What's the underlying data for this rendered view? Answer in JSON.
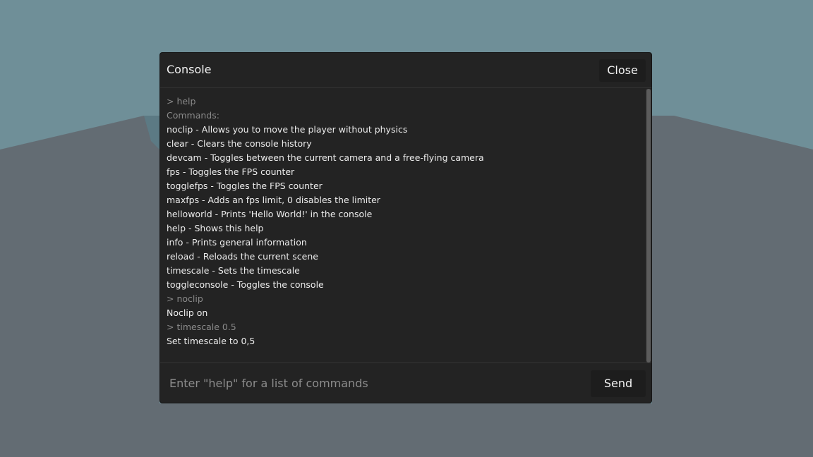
{
  "window": {
    "title": "Console",
    "close_label": "Close"
  },
  "log": [
    {
      "text": "> help",
      "kind": "command"
    },
    {
      "text": "Commands:",
      "kind": "command"
    },
    {
      "text": "noclip - Allows you to move the player without physics",
      "kind": "output"
    },
    {
      "text": "clear - Clears the console history",
      "kind": "output"
    },
    {
      "text": "devcam - Toggles between the current camera and a free-flying camera",
      "kind": "output"
    },
    {
      "text": "fps - Toggles the FPS counter",
      "kind": "output"
    },
    {
      "text": "togglefps - Toggles the FPS counter",
      "kind": "output"
    },
    {
      "text": "maxfps - Adds an fps limit, 0 disables the limiter",
      "kind": "output"
    },
    {
      "text": "helloworld - Prints 'Hello World!' in the console",
      "kind": "output"
    },
    {
      "text": "help - Shows this help",
      "kind": "output"
    },
    {
      "text": "info - Prints general information",
      "kind": "output"
    },
    {
      "text": "reload - Reloads the current scene",
      "kind": "output"
    },
    {
      "text": "timescale - Sets the timescale",
      "kind": "output"
    },
    {
      "text": "toggleconsole - Toggles the console",
      "kind": "output"
    },
    {
      "text": "> noclip",
      "kind": "command"
    },
    {
      "text": "Noclip on",
      "kind": "output"
    },
    {
      "text": "> timescale 0.5",
      "kind": "command"
    },
    {
      "text": "Set timescale to 0,5",
      "kind": "output"
    }
  ],
  "input": {
    "placeholder": "Enter \"help\" for a list of commands",
    "value": ""
  },
  "send_label": "Send",
  "colors": {
    "sky": "#6f8f98",
    "ground": "#636c73",
    "panel_bg": "#232323",
    "output_text": "#ececec",
    "command_text": "#8a8a8a"
  }
}
